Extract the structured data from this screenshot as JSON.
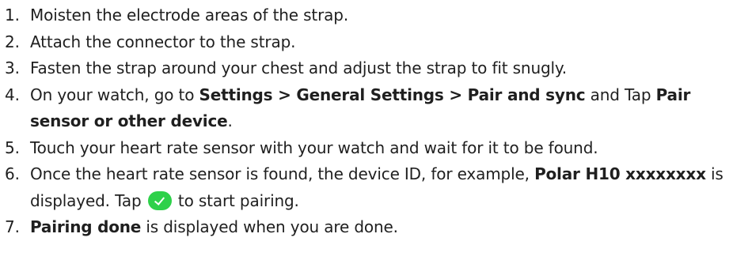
{
  "steps": [
    {
      "number": "1.",
      "parts": [
        "Moisten the electrode areas of the strap."
      ]
    },
    {
      "number": "2.",
      "parts": [
        "Attach the connector to the strap."
      ]
    },
    {
      "number": "3.",
      "parts": [
        "Fasten the strap around your chest and adjust the strap to fit snugly."
      ]
    },
    {
      "number": "4.",
      "parts": [
        "On your watch, go to ",
        "Settings > General Settings > Pair and sync",
        " and Tap ",
        "Pair sensor or other device",
        "."
      ]
    },
    {
      "number": "5.",
      "parts": [
        "Touch your heart rate sensor with your watch and wait for it to be found."
      ]
    },
    {
      "number": "6.",
      "parts": [
        "Once the heart rate sensor is found, the device ID, for example, ",
        "Polar H10 xxxxxxxx",
        " is displayed. Tap ",
        " to start pairing."
      ]
    },
    {
      "number": "7.",
      "parts": [
        "Pairing done",
        " is displayed when you are done."
      ]
    }
  ],
  "icons": {
    "confirm": "check-circle-icon"
  },
  "colors": {
    "text": "#1f1f1f",
    "confirm_icon": "#2ed14a"
  }
}
